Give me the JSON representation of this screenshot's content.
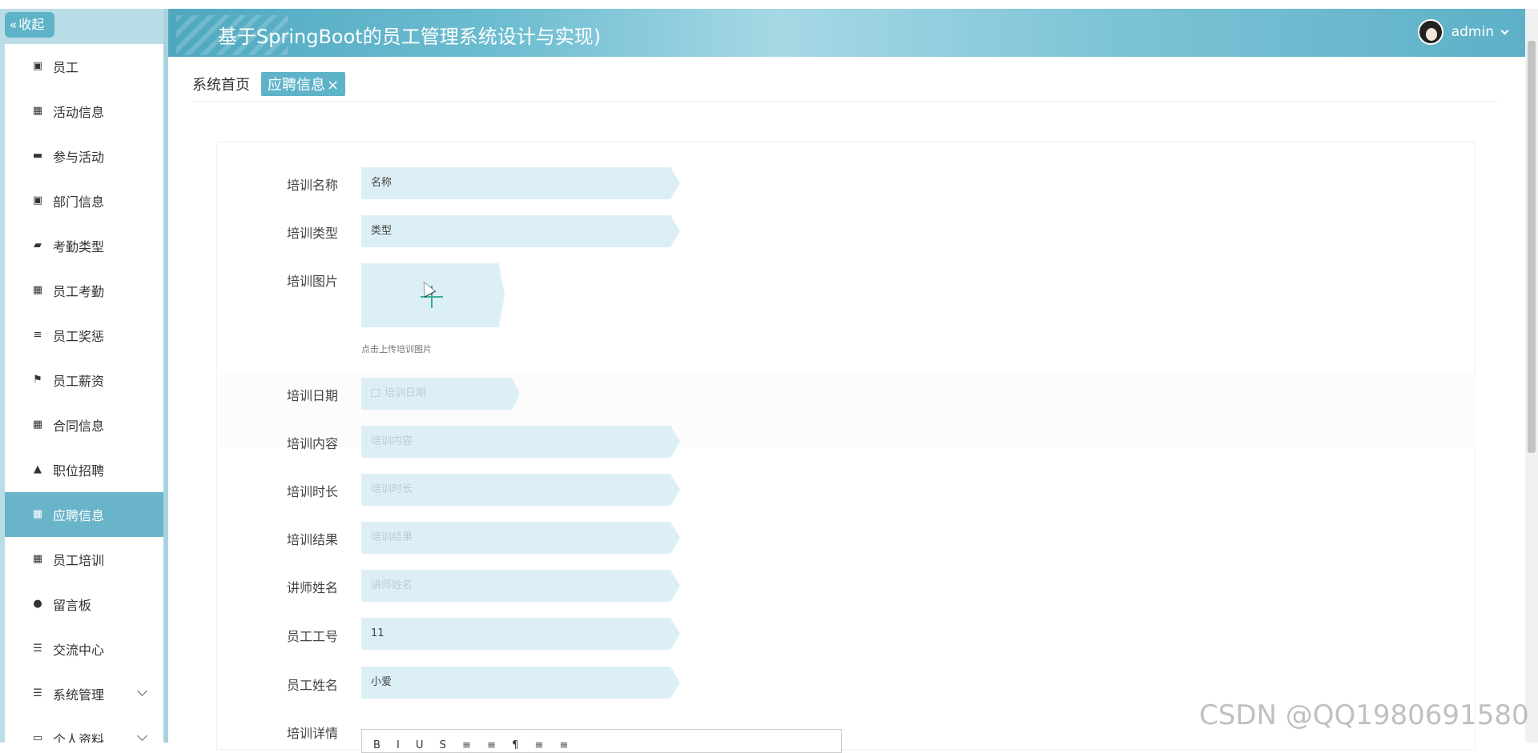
{
  "sidebar": {
    "collapse_label": "收起",
    "items": [
      {
        "label": "员工",
        "icon": "clipboard-check-icon",
        "glyph": "▣"
      },
      {
        "label": "活动信息",
        "icon": "grid-icon",
        "glyph": "▦"
      },
      {
        "label": "参与活动",
        "icon": "monitor-icon",
        "glyph": "▬"
      },
      {
        "label": "部门信息",
        "icon": "clipboard-x-icon",
        "glyph": "▣"
      },
      {
        "label": "考勤类型",
        "icon": "briefcase-icon",
        "glyph": "▰"
      },
      {
        "label": "员工考勤",
        "icon": "grid-icon",
        "glyph": "▦"
      },
      {
        "label": "员工奖惩",
        "icon": "sliders-icon",
        "glyph": "≡"
      },
      {
        "label": "员工薪资",
        "icon": "flag-icon",
        "glyph": "⚑"
      },
      {
        "label": "合同信息",
        "icon": "apps-icon",
        "glyph": "▦"
      },
      {
        "label": "职位招聘",
        "icon": "user-icon",
        "glyph": "▲"
      },
      {
        "label": "应聘信息",
        "icon": "grid-icon",
        "glyph": "▦",
        "active": true
      },
      {
        "label": "员工培训",
        "icon": "grid-icon",
        "glyph": "▦"
      },
      {
        "label": "留言板",
        "icon": "pin-icon",
        "glyph": "●"
      },
      {
        "label": "交流中心",
        "icon": "list-icon",
        "glyph": "☰"
      },
      {
        "label": "系统管理",
        "icon": "menu-icon",
        "glyph": "☰",
        "expandable": true
      },
      {
        "label": "个人资料",
        "icon": "card-icon",
        "glyph": "▭",
        "expandable": true
      }
    ]
  },
  "header": {
    "title": "基于SpringBoot的员工管理系统设计与实现)",
    "username": "admin"
  },
  "tabs": {
    "home": "系统首页",
    "active": "应聘信息",
    "close": "×"
  },
  "form": {
    "name_label": "培训名称",
    "name_value": "名称",
    "type_label": "培训类型",
    "type_value": "类型",
    "image_label": "培训图片",
    "image_tip": "点击上传培训图片",
    "date_label": "培训日期",
    "date_placeholder": "培训日期",
    "content_label": "培训内容",
    "content_placeholder": "培训内容",
    "duration_label": "培训时长",
    "duration_placeholder": "培训时长",
    "result_label": "培训结果",
    "result_placeholder": "培训结果",
    "teacher_label": "讲师姓名",
    "teacher_placeholder": "讲师姓名",
    "empno_label": "员工工号",
    "empno_value": "11",
    "empname_label": "员工姓名",
    "empname_value": "小爱",
    "detail_label": "培训详情"
  },
  "watermark": "CSDN @QQ1980691580"
}
